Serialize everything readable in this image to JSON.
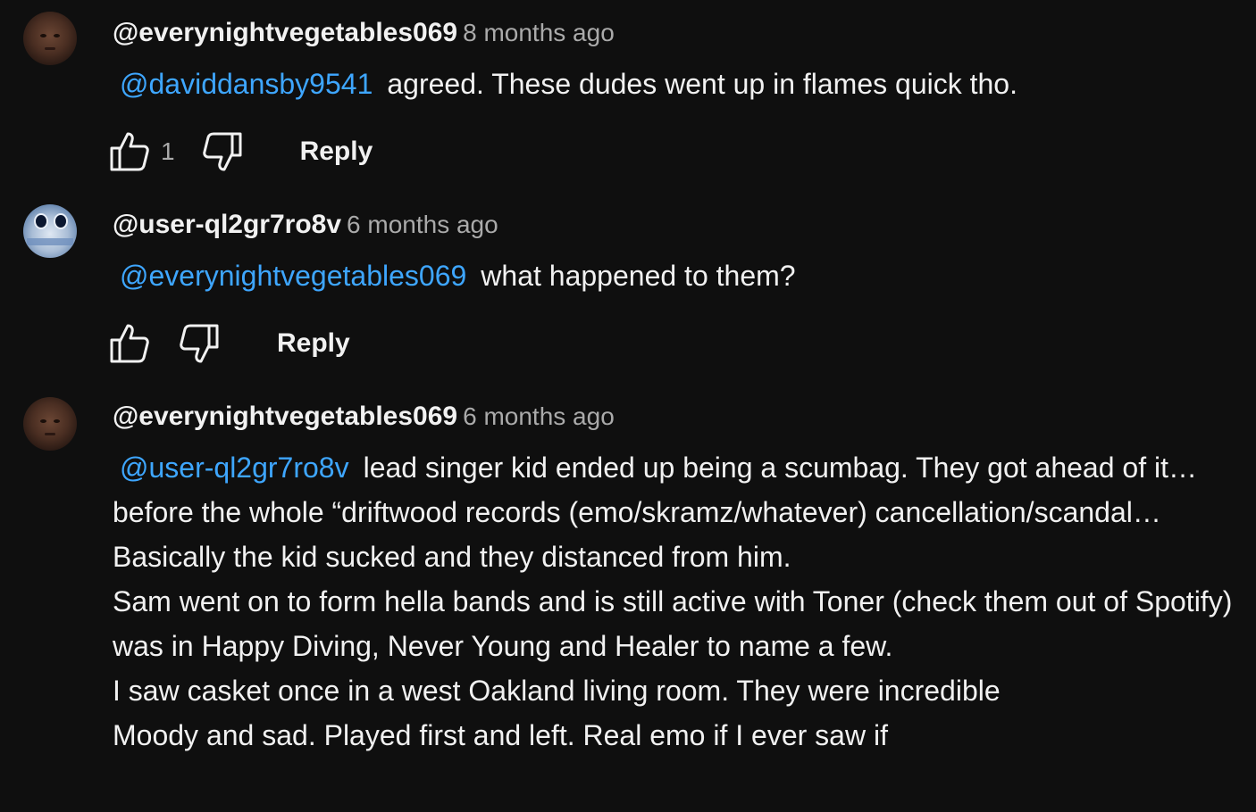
{
  "comments": [
    {
      "author": "@everynightvegetables069",
      "time": "8 months ago",
      "mention": "@daviddansby9541",
      "text": "agreed. These dudes went up in flames quick tho.",
      "likes": "1",
      "reply_label": "Reply"
    },
    {
      "author": "@user-ql2gr7ro8v",
      "time": "6 months ago",
      "mention": "@everynightvegetables069",
      "text": "what happened to them?",
      "likes": "",
      "reply_label": "Reply"
    },
    {
      "author": "@everynightvegetables069",
      "time": "6 months ago",
      "mention": "@user-ql2gr7ro8v",
      "text": "lead singer kid ended up being a scumbag. They got ahead of it… before the whole “driftwood records (emo/skramz/whatever) cancellation/scandal…\nBasically the kid sucked and they distanced from him.\nSam went on to form hella bands and is still active with Toner (check them out of Spotify) was in Happy Diving, Never Young and Healer to name a few.\nI saw casket once in a west Oakland living room. They were incredible\nMoody and sad. Played first and left. Real emo if I ever saw if"
    }
  ],
  "icons": {
    "like": "thumbs-up-icon",
    "dislike": "thumbs-down-icon"
  },
  "colors": {
    "background": "#0f0f0f",
    "text": "#f1f1f1",
    "secondary_text": "#aaaaaa",
    "mention": "#3ea6ff"
  }
}
